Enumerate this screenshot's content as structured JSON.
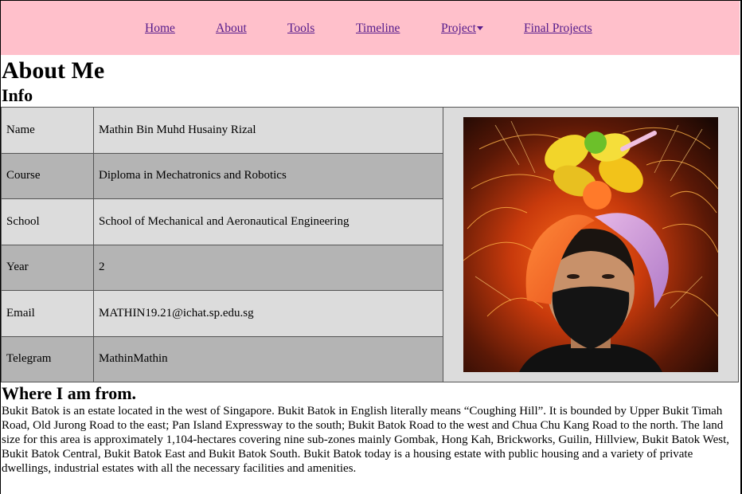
{
  "nav": {
    "items": [
      {
        "label": "Home"
      },
      {
        "label": "About"
      },
      {
        "label": "Tools"
      },
      {
        "label": "Timeline"
      },
      {
        "label": "Project"
      },
      {
        "label": "Final Projects"
      }
    ],
    "background_color": "#ffc0cb",
    "link_color": "#551a8b"
  },
  "page": {
    "title": "About Me",
    "info_heading": "Info",
    "origin_heading": "Where I am from."
  },
  "info": {
    "rows": [
      {
        "label": "Name",
        "value": "Mathin Bin Muhd Husainy Rizal"
      },
      {
        "label": "Course",
        "value": "Diploma in Mechatronics and Robotics"
      },
      {
        "label": "School",
        "value": "School of Mechanical and Aeronautical Engineering"
      },
      {
        "label": "Year",
        "value": "2"
      },
      {
        "label": "Email",
        "value": "MATHIN19.21@ichat.sp.edu.sg"
      },
      {
        "label": "Telegram",
        "value": "MathinMathin"
      }
    ],
    "row_colors": [
      "#dcdcdc",
      "#b4b4b4"
    ]
  },
  "origin": {
    "text": "Bukit Batok is an estate located in the west of Singapore. Bukit Batok in English literally means “Coughing Hill”. It is bounded by Upper Bukit Timah Road, Old Jurong Road to the east; Pan Island Expressway to the south; Bukit Batok Road to the west and Chua Chu Kang Road to the north. The land size for this area is approximately 1,104-hectares covering nine sub-zones mainly Gombak, Hong Kah, Brickworks, Guilin, Hillview, Bukit Batok West, Bukit Batok Central, Bukit Batok East and Bukit Batok South. Bukit Batok today is a housing estate with public housing and a variety of private dwellings, industrial estates with all the necessary facilities and amenities."
  }
}
